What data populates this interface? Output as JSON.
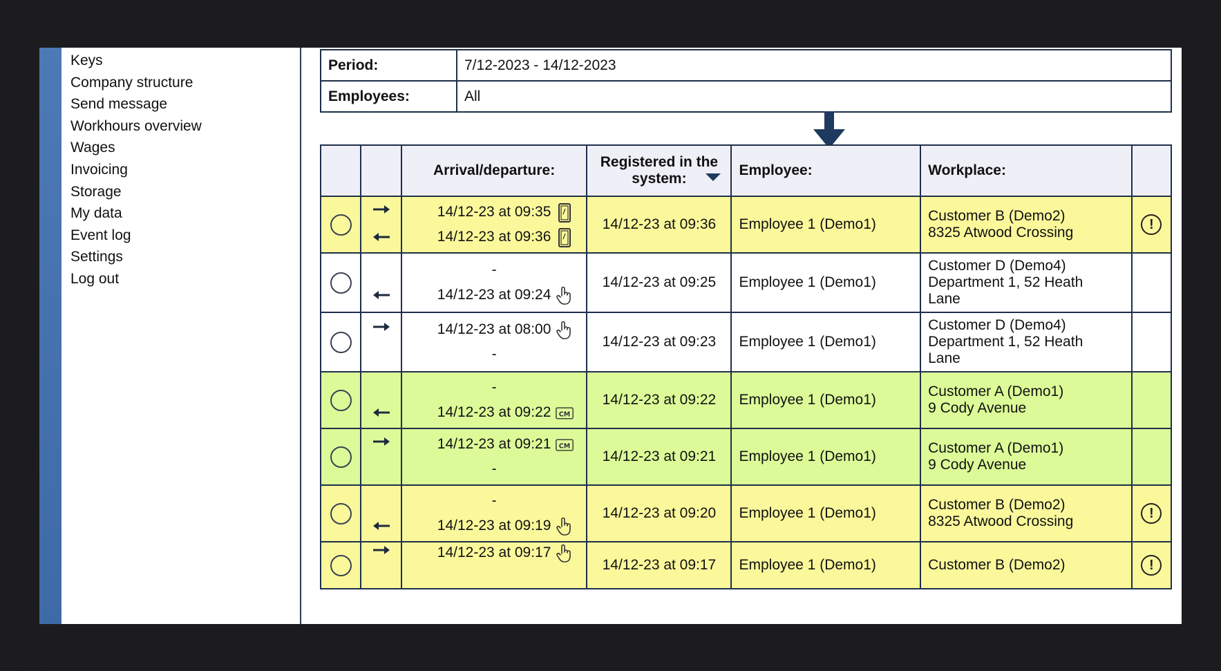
{
  "sidebar": {
    "items": [
      {
        "label": "Keys"
      },
      {
        "label": "Company structure"
      },
      {
        "label": "Send message"
      },
      {
        "label": "Workhours overview"
      },
      {
        "label": "Wages"
      },
      {
        "label": "Invoicing"
      },
      {
        "label": "Storage"
      },
      {
        "label": "My data"
      },
      {
        "label": "Event log"
      },
      {
        "label": "Settings"
      },
      {
        "label": "Log out"
      }
    ]
  },
  "filters": {
    "period_label": "Period:",
    "period_value": "7/12-2023 - 14/12-2023",
    "employees_label": "Employees:",
    "employees_value": "All"
  },
  "table": {
    "headers": {
      "arrival": "Arrival/departure:",
      "registered": "Registered in the system:",
      "employee": "Employee:",
      "workplace": "Workplace:"
    },
    "rows": [
      {
        "color": "yellow",
        "arrival": "14/12-23 at 09:35",
        "arrival_icon": "phone-icon",
        "departure": "14/12-23 at 09:36",
        "departure_icon": "phone-icon",
        "registered": "14/12-23 at 09:36",
        "employee": "Employee 1 (Demo1)",
        "workplace": [
          "Customer B (Demo2)",
          "8325 Atwood Crossing"
        ],
        "warning": true
      },
      {
        "color": "white",
        "arrival": "-",
        "arrival_icon": "",
        "departure": "14/12-23 at 09:24",
        "departure_icon": "hand-pointer-icon",
        "registered": "14/12-23 at 09:25",
        "employee": "Employee 1 (Demo1)",
        "workplace": [
          "Customer D (Demo4)",
          "Department 1, 52 Heath",
          "Lane"
        ],
        "warning": false
      },
      {
        "color": "white",
        "arrival": "14/12-23 at 08:00",
        "arrival_icon": "hand-pointer-icon",
        "departure": "-",
        "departure_icon": "",
        "registered": "14/12-23 at 09:23",
        "employee": "Employee 1 (Demo1)",
        "workplace": [
          "Customer D (Demo4)",
          "Department 1, 52 Heath",
          "Lane"
        ],
        "warning": false
      },
      {
        "color": "green",
        "arrival": "-",
        "arrival_icon": "",
        "departure": "14/12-23 at 09:22",
        "departure_icon": "cm-badge-icon",
        "registered": "14/12-23 at 09:22",
        "employee": "Employee 1 (Demo1)",
        "workplace": [
          "Customer A (Demo1)",
          "9 Cody Avenue"
        ],
        "warning": false
      },
      {
        "color": "green",
        "arrival": "14/12-23 at 09:21",
        "arrival_icon": "cm-badge-icon",
        "departure": "-",
        "departure_icon": "",
        "registered": "14/12-23 at 09:21",
        "employee": "Employee 1 (Demo1)",
        "workplace": [
          "Customer A (Demo1)",
          "9 Cody Avenue"
        ],
        "warning": false
      },
      {
        "color": "yellow",
        "arrival": "-",
        "arrival_icon": "",
        "departure": "14/12-23 at 09:19",
        "departure_icon": "hand-pointer-icon",
        "registered": "14/12-23 at 09:20",
        "employee": "Employee 1 (Demo1)",
        "workplace": [
          "Customer B (Demo2)",
          "8325 Atwood Crossing"
        ],
        "warning": true
      },
      {
        "color": "yellow",
        "arrival": "14/12-23 at 09:17",
        "arrival_icon": "hand-pointer-icon",
        "departure": "",
        "departure_icon": "",
        "registered": "14/12-23 at 09:17",
        "employee": "Employee 1 (Demo1)",
        "workplace": [
          "Customer B (Demo2)"
        ],
        "warning": true
      }
    ],
    "warning_symbol": "!"
  }
}
